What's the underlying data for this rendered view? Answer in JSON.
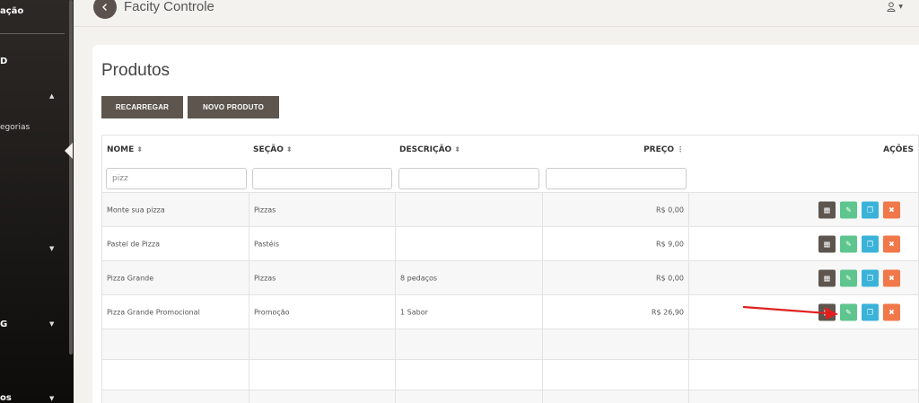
{
  "sidebar": {
    "items": [
      {
        "label": "ação"
      },
      {
        "label": "D"
      },
      {
        "label": "egorias"
      },
      {
        "label": "G"
      },
      {
        "label": "os"
      }
    ]
  },
  "topbar": {
    "title": "Facity Controle",
    "back_icon": "chevron-left-icon",
    "user_icon": "user-icon"
  },
  "main": {
    "title": "Produtos",
    "buttons": {
      "reload": "RECARREGAR",
      "new": "NOVO PRODUTO"
    },
    "table": {
      "headers": {
        "name": "NOME",
        "section": "SEÇÃO",
        "description": "DESCRIÇÃO",
        "price": "PREÇO",
        "actions": "AÇÕES"
      },
      "filters": {
        "name": "pizz",
        "section": "",
        "description": "",
        "price": ""
      },
      "rows": [
        {
          "name": "Monte sua pizza",
          "section": "Pizzas",
          "description": "",
          "price": "R$ 0,00"
        },
        {
          "name": "Pastel de Pizza",
          "section": "Pastéis",
          "description": "",
          "price": "R$ 9,00"
        },
        {
          "name": "Pizza Grande",
          "section": "Pizzas",
          "description": "8 pedaços",
          "price": "R$ 0,00"
        },
        {
          "name": "Pizza Grande Promocional",
          "section": "Promoção",
          "description": "1 Sabor",
          "price": "R$ 26,90"
        }
      ],
      "action_icons": [
        "list-icon",
        "edit-icon",
        "copy-icon",
        "delete-icon"
      ]
    }
  },
  "colors": {
    "primary_dark": "#5d554e",
    "edit_green": "#5ec58f",
    "copy_blue": "#3bb3d9",
    "delete_orange": "#f0784a",
    "annotation_red": "#e02020"
  }
}
